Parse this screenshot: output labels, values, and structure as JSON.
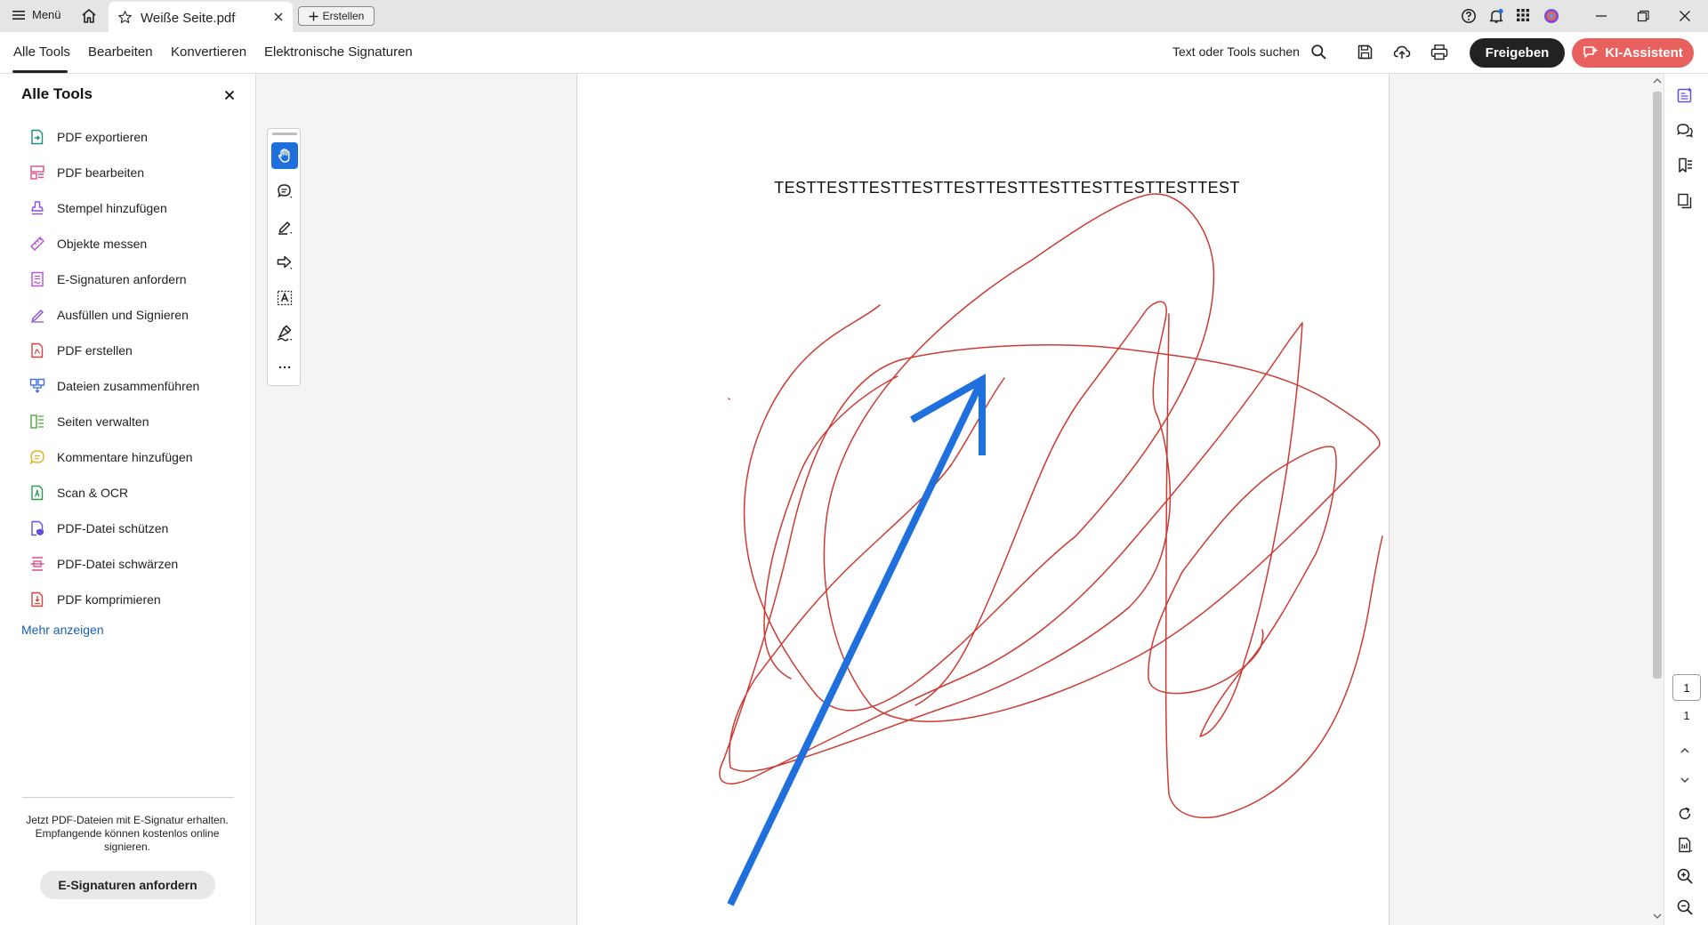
{
  "titlebar": {
    "menu_label": "Menü",
    "tab_title": "Weiße Seite.pdf",
    "create_label": "Erstellen"
  },
  "toolbar": {
    "tabs": [
      "Alle Tools",
      "Bearbeiten",
      "Konvertieren",
      "Elektronische Signaturen"
    ],
    "active_tab": "Alle Tools",
    "search_label": "Text oder Tools suchen",
    "share_label": "Freigeben",
    "ai_label": "KI-Assistent"
  },
  "left_panel": {
    "title": "Alle Tools",
    "tools": [
      {
        "label": "PDF exportieren",
        "icon": "export-pdf-icon",
        "color": "#1f8a7a"
      },
      {
        "label": "PDF bearbeiten",
        "icon": "edit-pdf-icon",
        "color": "#d94f8a"
      },
      {
        "label": "Stempel hinzufügen",
        "icon": "stamp-icon",
        "color": "#8a4fd9"
      },
      {
        "label": "Objekte messen",
        "icon": "ruler-icon",
        "color": "#b04fd9"
      },
      {
        "label": "E-Signaturen anfordern",
        "icon": "request-signature-icon",
        "color": "#b04fd9"
      },
      {
        "label": "Ausfüllen und Signieren",
        "icon": "fill-sign-icon",
        "color": "#8a4fd9"
      },
      {
        "label": "PDF erstellen",
        "icon": "create-pdf-icon",
        "color": "#d9423f"
      },
      {
        "label": "Dateien zusammenführen",
        "icon": "combine-files-icon",
        "color": "#3f6fd9"
      },
      {
        "label": "Seiten verwalten",
        "icon": "organize-pages-icon",
        "color": "#4fa33f"
      },
      {
        "label": "Kommentare hinzufügen",
        "icon": "comment-icon",
        "color": "#e0b01f"
      },
      {
        "label": "Scan & OCR",
        "icon": "scan-ocr-icon",
        "color": "#2f9a4f"
      },
      {
        "label": "PDF-Datei schützen",
        "icon": "protect-icon",
        "color": "#5f4fd9"
      },
      {
        "label": "PDF-Datei schwärzen",
        "icon": "redact-icon",
        "color": "#d94f8a"
      },
      {
        "label": "PDF komprimieren",
        "icon": "compress-icon",
        "color": "#d9423f"
      }
    ],
    "more_label": "Mehr anzeigen",
    "promo_text": "Jetzt PDF-Dateien mit E-Signatur erhalten. Empfangende können kostenlos online signieren.",
    "promo_button": "E-Signaturen anfordern"
  },
  "document": {
    "text": "TESTTESTTESTTESTTESTTESTTESTTESTTESTTESTTEST",
    "ink_color": "#cc3b33",
    "arrow_color": "#1f6fdc"
  },
  "quick_tools": [
    "hand-tool-icon",
    "add-comment-icon",
    "highlight-icon",
    "arrow-tool-icon",
    "text-select-icon",
    "draw-icon",
    "more-icon"
  ],
  "right_rail": {
    "current_page": "1",
    "total_pages": "1"
  },
  "colors": {
    "accent": "#1f6fdc",
    "share_bg": "#222222",
    "ai_bg": "#e8615e"
  }
}
